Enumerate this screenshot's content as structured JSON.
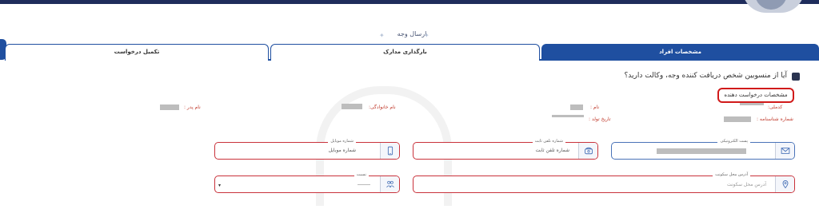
{
  "page": {
    "heading": "ارسال وجه"
  },
  "tabs": [
    {
      "label": "تکمیل درخواست",
      "active": false
    },
    {
      "label": "بارگذاری مدارک",
      "active": false
    },
    {
      "label": "مشخصات افراد",
      "active": true
    }
  ],
  "question": {
    "text": "آیا از منسوبین شخص دریافت کننده وجه، وکالت دارید؟"
  },
  "section": {
    "title": "مشخصات درخواست دهنده"
  },
  "info_labels": {
    "name": "نام :",
    "family": "نام خانوادگی:",
    "father": "نام پدر :",
    "national_code": "کدملی:",
    "birth_date": "تاریخ تولد :",
    "id_number": "شماره شناسنامه :"
  },
  "fields": {
    "email": {
      "label": "پست الکترونیکی"
    },
    "landline": {
      "label": "شماره تلفن ثابت",
      "value": "شماره تلفن ثابت"
    },
    "mobile": {
      "label": "شماره موبایل",
      "value": "شماره موبایل"
    },
    "address": {
      "label": "آدرس محل سکونت",
      "placeholder": "آدرس محل سکونت"
    },
    "relation": {
      "label": "نسبت"
    }
  },
  "icons": {
    "email": "envelope-icon",
    "landline": "phone-icon",
    "mobile": "mobile-icon",
    "address": "location-icon",
    "relation": "people-icon",
    "dropdown": "caret-down-icon"
  },
  "colors": {
    "primary": "#1f4fa0",
    "error_border": "#c9323b",
    "highlight": "#d11a1a",
    "dark_navy": "#1f2d5c"
  }
}
